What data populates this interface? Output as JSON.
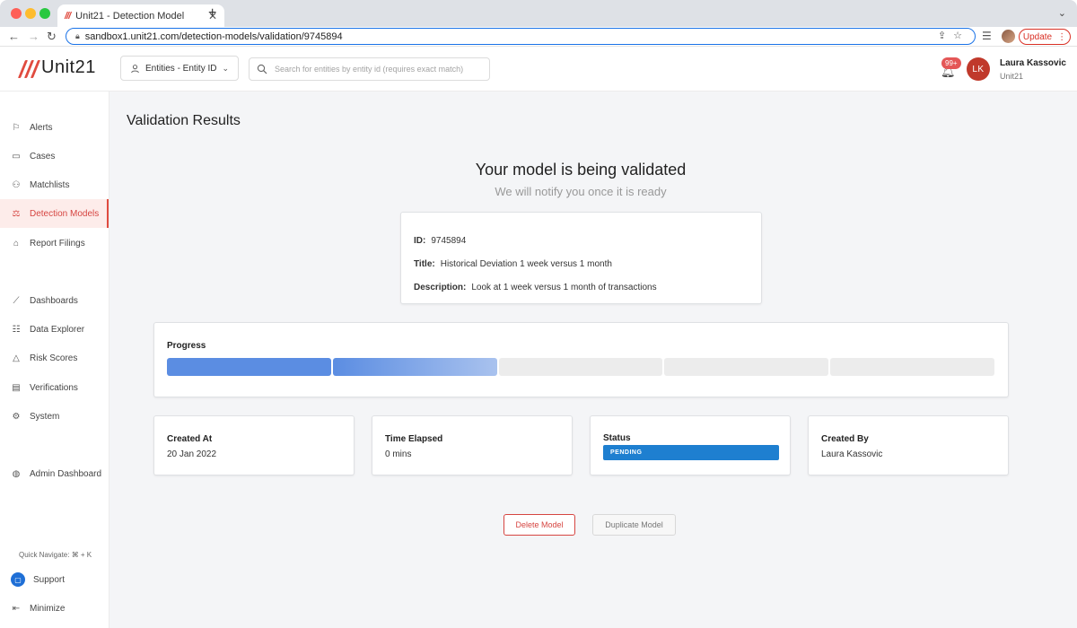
{
  "browser": {
    "tab_title": "Unit21 - Detection Model",
    "favicon_text": "///",
    "url": "sandbox1.unit21.com/detection-models/validation/9745894",
    "update_label": "Update"
  },
  "header": {
    "logo_text": "Unit21",
    "entity_select_label": "Entities - Entity ID",
    "search_placeholder": "Search for entities by entity id (requires exact match)",
    "notification_count": "99+",
    "user": {
      "initials": "LK",
      "name": "Laura Kassovic",
      "org": "Unit21"
    }
  },
  "sidebar": {
    "items": [
      {
        "label": "Alerts",
        "icon": "flag-icon"
      },
      {
        "label": "Cases",
        "icon": "briefcase-icon"
      },
      {
        "label": "Matchlists",
        "icon": "user-plus-icon"
      },
      {
        "label": "Detection Models",
        "icon": "scale-icon"
      },
      {
        "label": "Report Filings",
        "icon": "bank-icon"
      },
      {
        "label": "Dashboards",
        "icon": "chart-line-icon"
      },
      {
        "label": "Data Explorer",
        "icon": "search-list-icon"
      },
      {
        "label": "Risk Scores",
        "icon": "warning-icon"
      },
      {
        "label": "Verifications",
        "icon": "id-card-icon"
      },
      {
        "label": "System",
        "icon": "gear-icon"
      },
      {
        "label": "Admin Dashboard",
        "icon": "globe-icon"
      }
    ],
    "active_item": "Detection Models",
    "quick_navigate": "Quick Navigate: ⌘ + K",
    "support_label": "Support",
    "minimize_label": "Minimize"
  },
  "main": {
    "page_title": "Validation Results",
    "hero_title": "Your model is being validated",
    "hero_subtitle": "We will notify you once it is ready",
    "model": {
      "id_label": "ID:",
      "id_value": "9745894",
      "title_label": "Title:",
      "title_value": "Historical Deviation 1 week versus 1 month",
      "description_label": "Description:",
      "description_value": "Look at 1 week versus 1 month of transactions"
    },
    "progress": {
      "label": "Progress",
      "segments_total": 5,
      "segments_complete": 1.5
    },
    "stats": {
      "created_at": {
        "label": "Created At",
        "value": "20 Jan 2022"
      },
      "time_elapsed": {
        "label": "Time Elapsed",
        "value": "0 mins"
      },
      "status": {
        "label": "Status",
        "value": "PENDING"
      },
      "created_by": {
        "label": "Created By",
        "value": "Laura Kassovic"
      }
    },
    "actions": {
      "delete_label": "Delete Model",
      "duplicate_label": "Duplicate Model"
    }
  },
  "colors": {
    "brand_red": "#e04b3f",
    "progress_blue": "#5b8de2",
    "status_blue": "#1e7fd0"
  }
}
